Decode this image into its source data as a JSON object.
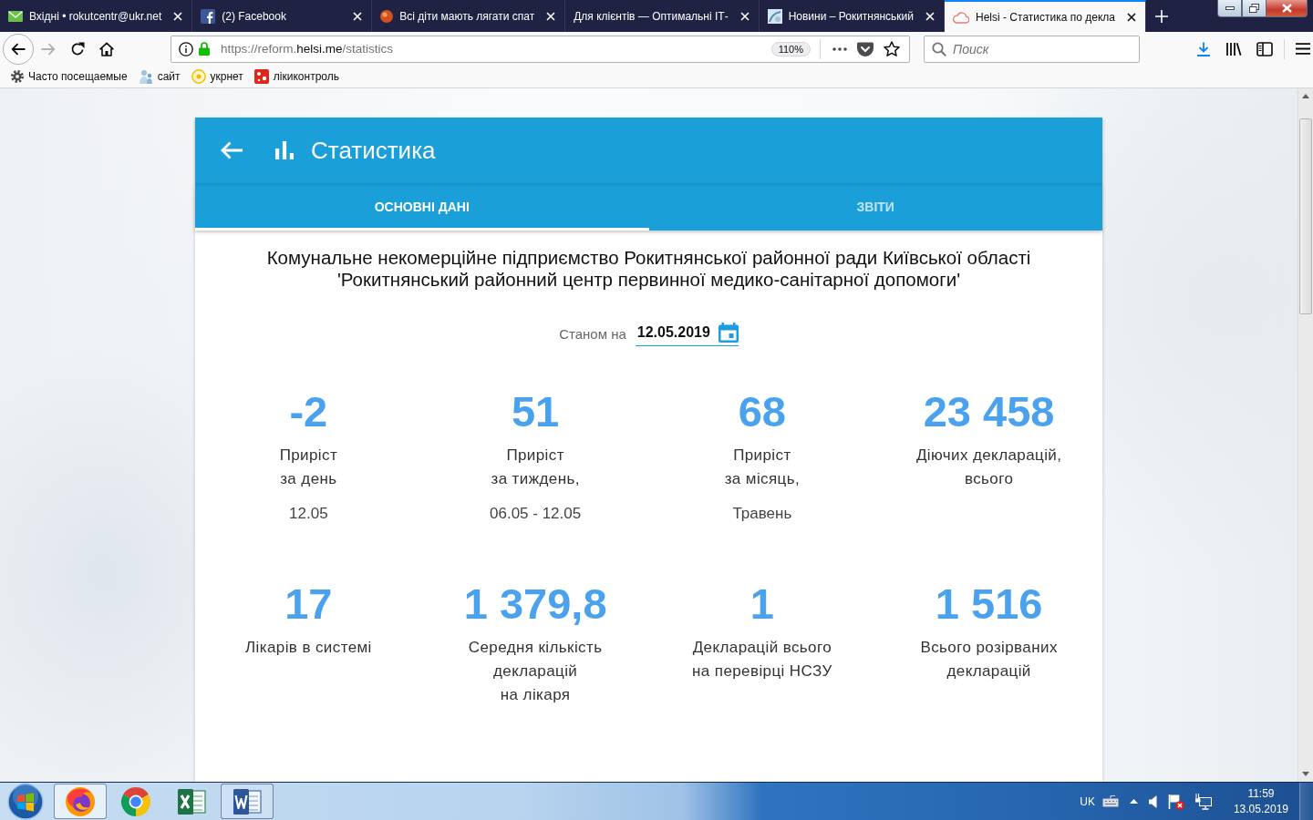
{
  "browser": {
    "tabs": [
      {
        "title": "Вхідні • rokutcentr@ukr.net",
        "kind": "mail",
        "selected": false
      },
      {
        "title": "(2) Facebook",
        "kind": "facebook",
        "selected": false
      },
      {
        "title": "Всі діти мають лягати спат",
        "kind": "ball",
        "selected": false
      },
      {
        "title": "Для клієнтів — Оптимальні ІТ-",
        "selected": false
      },
      {
        "title": "Новини – Рокитнянський",
        "kind": "photo",
        "selected": false
      },
      {
        "title": "Helsi - Статистика по декла",
        "kind": "cloud",
        "selected": true
      }
    ],
    "address": {
      "url": "https://reform.**helsi.me**/statistics",
      "zoom": "110%"
    },
    "search": {
      "placeholder": "Поиск"
    },
    "bookmarks": [
      {
        "label": "Часто посещаемые",
        "kind": "gear"
      },
      {
        "label": "сайт",
        "kind": "people"
      },
      {
        "label": "укрнет",
        "kind": "ring"
      },
      {
        "label": "лікиконтроль",
        "kind": "pills"
      }
    ]
  },
  "page": {
    "header": {
      "title": "Статистика"
    },
    "tabs": [
      {
        "label": "ОСНОВНІ ДАНІ",
        "selected": true
      },
      {
        "label": "ЗВІТИ",
        "selected": false
      }
    ],
    "organization": [
      "Комунальне некомерційне підприємство Рокитнянської районної ради Київської області",
      "'Рокитнянський районний центр первинної медико-санітарної допомоги'"
    ],
    "date": {
      "label": "Станом на",
      "value": "12.05.2019"
    },
    "stats": [
      {
        "value": "-2",
        "label": [
          "Приріст",
          "за день"
        ],
        "period": "12.05"
      },
      {
        "value": "51",
        "label": [
          "Приріст",
          "за тиждень,"
        ],
        "period": "06.05 - 12.05"
      },
      {
        "value": "68",
        "label": [
          "Приріст",
          "за місяць,"
        ],
        "period": "Травень"
      },
      {
        "value": "23 458",
        "label": [
          "Діючих декларацій,",
          "всього"
        ]
      },
      {
        "value": "17",
        "label": [
          "Лікарів в системі"
        ]
      },
      {
        "value": "1 379,8",
        "label": [
          "Середня кількість",
          "декларацій",
          "на лікаря"
        ]
      },
      {
        "value": "1",
        "label": [
          "Декларацій всього",
          "на перевірці НСЗУ"
        ]
      },
      {
        "value": "1 516",
        "label": [
          "Всього розірваних",
          "декларацій"
        ]
      }
    ]
  },
  "taskbar": {
    "apps": [
      {
        "kind": "firefox",
        "running": true,
        "selected": true
      },
      {
        "kind": "chrome",
        "running": false,
        "selected": false
      },
      {
        "kind": "excel",
        "running": false,
        "selected": false
      },
      {
        "kind": "word",
        "running": true,
        "selected": false
      }
    ],
    "language": "UK",
    "time": "11:59",
    "date": "13.05.2019"
  }
}
